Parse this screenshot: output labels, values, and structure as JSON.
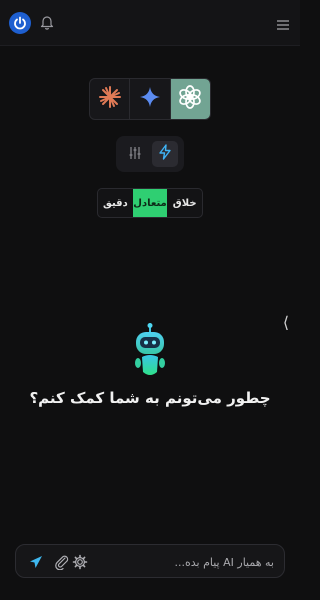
{
  "header": {
    "logo_icon": "power-icon",
    "notification_icon": "bell-icon",
    "menu_icon": "hamburger-menu-icon"
  },
  "model_selector": {
    "items": [
      {
        "icon": "claude-icon",
        "active": false
      },
      {
        "icon": "gemini-icon",
        "active": false
      },
      {
        "icon": "chatgpt-icon",
        "active": true
      }
    ]
  },
  "mode_switch": {
    "items": [
      {
        "icon": "sliders-icon",
        "active": false
      },
      {
        "icon": "lightning-icon",
        "active": true
      }
    ]
  },
  "tone_selector": {
    "left_label": "دقیق",
    "middle_label": "متعادل",
    "right_label": "خلاق",
    "selected": "متعادل",
    "accent": "#2fcf72"
  },
  "main": {
    "prompt": "چطور می‌تونم به شما کمک کنم؟",
    "mascot_icon": "robot-mascot-icon",
    "side_handle": "⟨"
  },
  "composer": {
    "placeholder": "به همیار AI پیام بده...",
    "value": ""
  },
  "colors": {
    "background": "#0f0f10",
    "active_model": "#72a493",
    "logo": "#1e5fd0"
  }
}
